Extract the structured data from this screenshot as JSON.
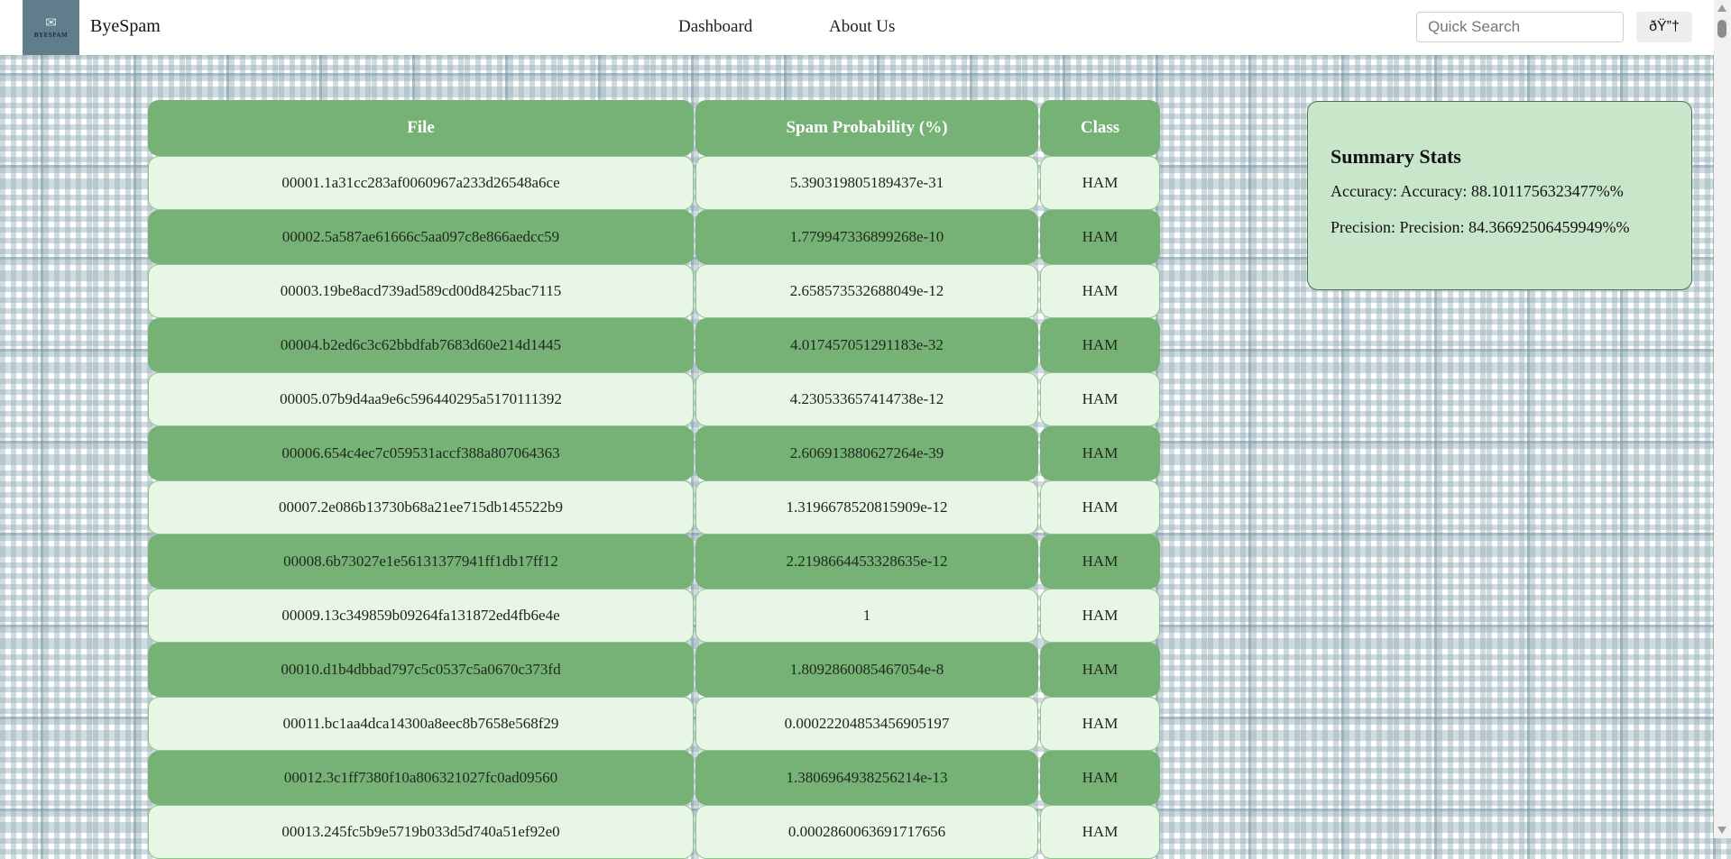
{
  "brand": {
    "logo_text": "BYESPAM",
    "name": "ByeSpam"
  },
  "nav": {
    "links": [
      "Dashboard",
      "About Us"
    ]
  },
  "search": {
    "placeholder": "Quick Search",
    "value": ""
  },
  "theme_toggle": {
    "label": "ðŸ”†"
  },
  "table": {
    "headers": [
      "File",
      "Spam Probability (%)",
      "Class"
    ],
    "rows": [
      [
        "00001.1a31cc283af0060967a233d26548a6ce",
        "5.390319805189437e-31",
        "HAM"
      ],
      [
        "00002.5a587ae61666c5aa097c8e866aedcc59",
        "1.779947336899268e-10",
        "HAM"
      ],
      [
        "00003.19be8acd739ad589cd00d8425bac7115",
        "2.658573532688049e-12",
        "HAM"
      ],
      [
        "00004.b2ed6c3c62bbdfab7683d60e214d1445",
        "4.017457051291183e-32",
        "HAM"
      ],
      [
        "00005.07b9d4aa9e6c596440295a5170111392",
        "4.230533657414738e-12",
        "HAM"
      ],
      [
        "00006.654c4ec7c059531accf388a807064363",
        "2.606913880627264e-39",
        "HAM"
      ],
      [
        "00007.2e086b13730b68a21ee715db145522b9",
        "1.3196678520815909e-12",
        "HAM"
      ],
      [
        "00008.6b73027e1e56131377941ff1db17ff12",
        "2.2198664453328635e-12",
        "HAM"
      ],
      [
        "00009.13c349859b09264fa131872ed4fb6e4e",
        "1",
        "HAM"
      ],
      [
        "00010.d1b4dbbad797c5c0537c5a0670c373fd",
        "1.8092860085467054e-8",
        "HAM"
      ],
      [
        "00011.bc1aa4dca14300a8eec8b7658e568f29",
        "0.00022204853456905197",
        "HAM"
      ],
      [
        "00012.3c1ff7380f10a806321027fc0ad09560",
        "1.3806964938256214e-13",
        "HAM"
      ],
      [
        "00013.245fc5b9e5719b033d5d740a51ef92e0",
        "0.0002860063691717656",
        "HAM"
      ]
    ]
  },
  "stats": {
    "title": "Summary Stats",
    "accuracy": "Accuracy: Accuracy: 88.1011756323477%%",
    "precision": "Precision: Precision: 84.36692506459949%%"
  },
  "colors": {
    "header_green": "#76b176",
    "row_light": "#e7f6e5",
    "stats_bg": "#c8e6c9",
    "logo_bg": "#5f7d8b"
  }
}
